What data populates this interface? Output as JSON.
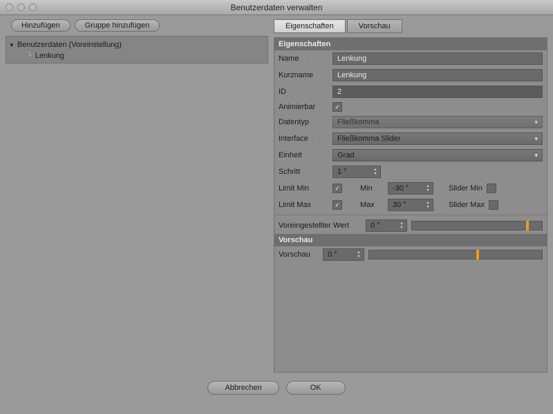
{
  "window": {
    "title": "Benutzerdaten verwalten"
  },
  "toolbar": {
    "add": "Hinzufügen",
    "add_group": "Gruppe hinzufügen"
  },
  "tree": {
    "root": "Benutzerdaten (Voreinstellung)",
    "children": [
      "Lenkung"
    ]
  },
  "tabs": {
    "props": "Eigenschaften",
    "preview": "Vorschau"
  },
  "section": {
    "props": "Eigenschaften",
    "preview": "Vorschau"
  },
  "labels": {
    "name": "Name",
    "shortname": "Kurzname",
    "id": "ID",
    "animatable": "Animierbar",
    "datatype": "Datentyp",
    "interface": "Interface",
    "unit": "Einheit",
    "step": "Schritt",
    "limit_min": "Limit Min",
    "limit_max": "Limit Max",
    "min": "Min",
    "max": "Max",
    "slider_min": "Slider Min",
    "slider_max": "Slider Max",
    "default": "Voreingestellter Wert",
    "preview": "Vorschau"
  },
  "values": {
    "name": "Lenkung",
    "shortname": "Lenkung",
    "id": "2",
    "animatable": true,
    "datatype": "Fließkomma",
    "interface": "Fließkomma Slider",
    "unit": "Grad",
    "step": "1 °",
    "limit_min": true,
    "limit_max": true,
    "min": "-30 °",
    "max": "30 °",
    "slider_min": false,
    "slider_max": false,
    "default": "0 °",
    "default_slider_pos": 0.88,
    "preview": "0 °",
    "preview_slider_pos": 0.62
  },
  "footer": {
    "cancel": "Abbrechen",
    "ok": "OK"
  }
}
